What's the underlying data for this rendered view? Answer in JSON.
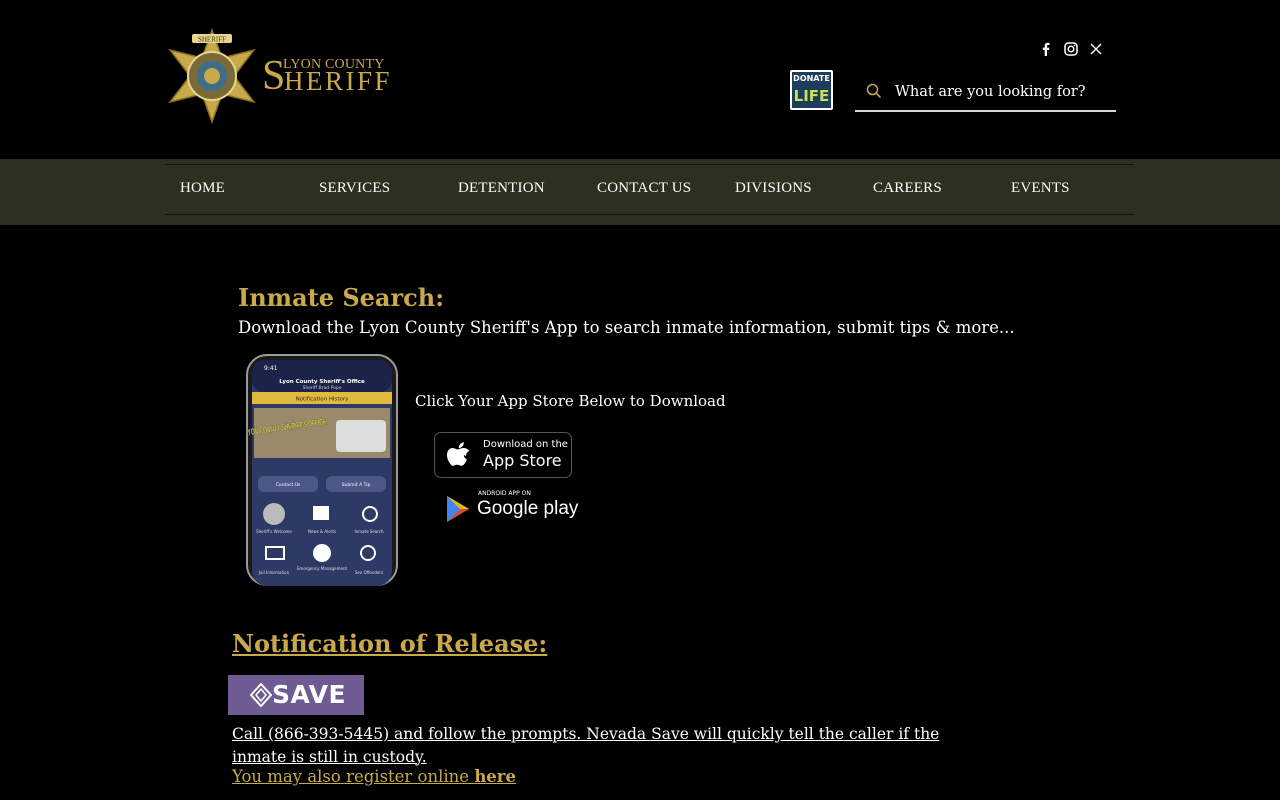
{
  "header": {
    "logo": {
      "line1": "LYON COUNTY",
      "line2": "HERIFF",
      "initial": "S"
    },
    "badge_text": "SHERIFF",
    "social": [
      "facebook-icon",
      "instagram-icon",
      "x-icon"
    ],
    "donate_badge": {
      "top": "DONATE",
      "bottom": "LIFE"
    },
    "search": {
      "placeholder": "What are you looking for?"
    }
  },
  "nav": {
    "items": [
      "HOME",
      "SERVICES",
      "DETENTION",
      "CONTACT US",
      "DIVISIONS",
      "CAREERS",
      "EVENTS"
    ]
  },
  "inmate": {
    "title": "Inmate Search:",
    "subtitle": "Download the Lyon County Sheriff's App to search inmate information, submit tips & more...",
    "click_text": "Click Your App Store Below to Download",
    "phone": {
      "time": "9:41",
      "office": "Lyon County Sheriff's Office",
      "sheriff": "Sheriff Brad Pope",
      "notification": "Notification History",
      "banner": "LYON COUNTY SHERIFF'S OFFICE",
      "btn_contact": "Contact Us",
      "btn_tip": "Submit A Tip",
      "tiles": [
        "Sheriff's Welcome",
        "News & Alerts",
        "Inmate Search",
        "Jail Information",
        "Emergency Management",
        "Sex Offenders"
      ]
    },
    "appstore": {
      "small": "Download on the",
      "big": "App Store"
    },
    "googleplay": {
      "small": "ANDROID APP ON",
      "big": "Google play"
    }
  },
  "release": {
    "title": "Notification of Release: ",
    "save_label": "SAVE",
    "body": "Call  (866-393-5445) and follow the prompts. Nevada Save will quickly tell the caller if the inmate is still in custody. ",
    "register_prefix": "You may also register online ",
    "register_link": "here"
  },
  "colors": {
    "gold": "#c9a94a",
    "nav_bg": "#2d2f1f",
    "save_purple": "#6e5b93"
  }
}
